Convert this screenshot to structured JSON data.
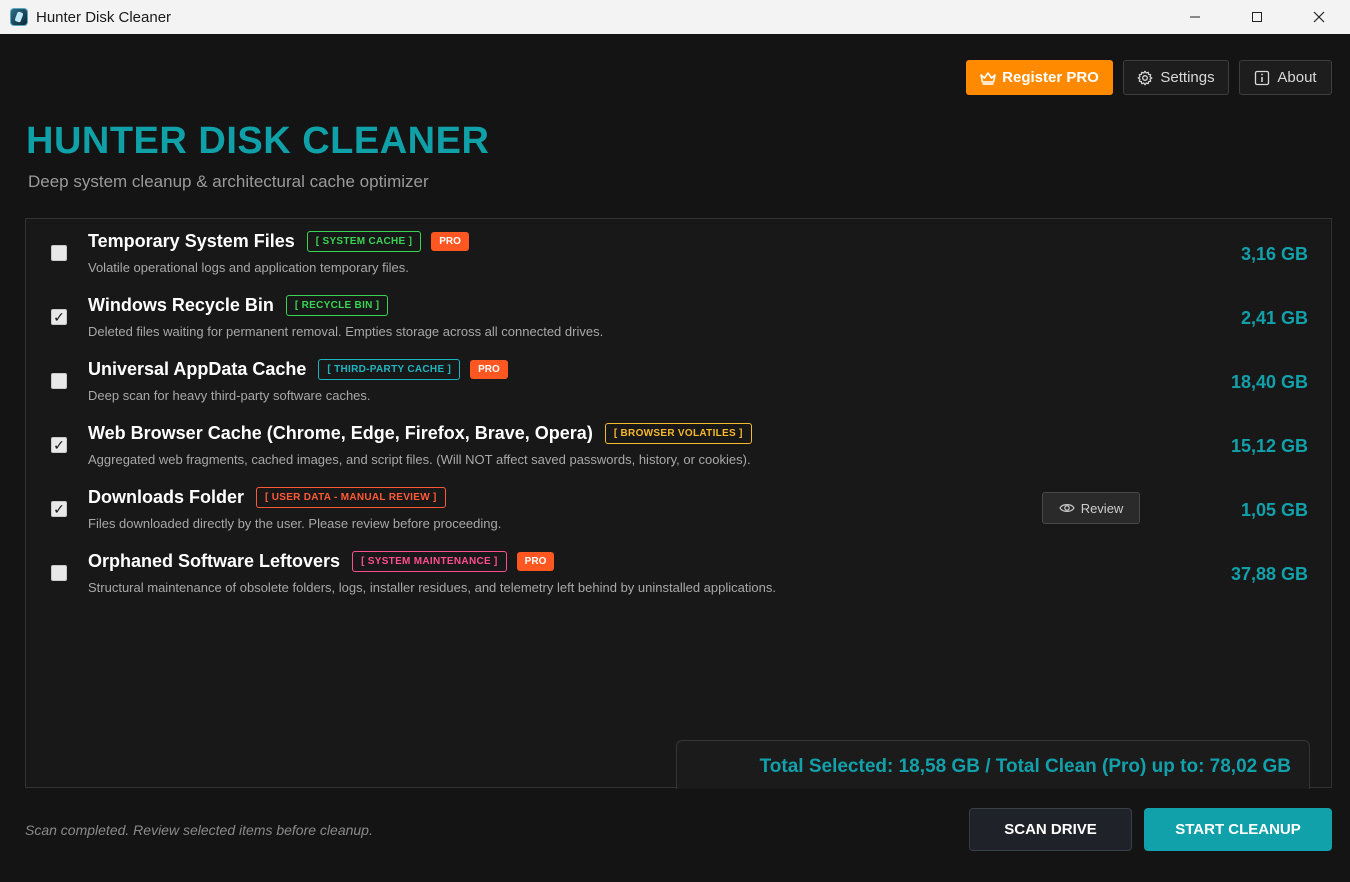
{
  "window": {
    "title": "Hunter Disk Cleaner"
  },
  "toolbar": {
    "register_label": "Register PRO",
    "settings_label": "Settings",
    "about_label": "About"
  },
  "header": {
    "title": "HUNTER DISK CLEANER",
    "subtitle": "Deep system cleanup & architectural cache optimizer"
  },
  "items": [
    {
      "title": "Temporary System Files",
      "tag": "[ SYSTEM CACHE ]",
      "tag_color": "#39d353",
      "pro": "PRO",
      "desc": "Volatile operational logs and application temporary files.",
      "size": "3,16 GB",
      "checked": false
    },
    {
      "title": "Windows Recycle Bin",
      "tag": "[ RECYCLE BIN ]",
      "tag_color": "#39d353",
      "desc": "Deleted files waiting for permanent removal. Empties storage across all connected drives.",
      "size": "2,41 GB",
      "checked": true
    },
    {
      "title": "Universal AppData Cache",
      "tag": "[ THIRD-PARTY CACHE ]",
      "tag_color": "#1fb5c0",
      "pro": "PRO",
      "desc": "Deep scan for heavy third-party software caches.",
      "size": "18,40 GB",
      "checked": false
    },
    {
      "title": "Web Browser Cache (Chrome, Edge, Firefox, Brave, Opera)",
      "tag": "[ BROWSER VOLATILES ]",
      "tag_color": "#f5b82e",
      "desc": "Aggregated web fragments, cached images, and script files. (Will NOT affect saved passwords, history, or cookies).",
      "size": "15,12 GB",
      "checked": true
    },
    {
      "title": "Downloads Folder",
      "tag": "[ USER DATA - MANUAL REVIEW ]",
      "tag_color": "#ff5a36",
      "desc": "Files downloaded directly by the user. Please review before proceeding.",
      "size": "1,05 GB",
      "checked": true,
      "review_label": "Review"
    },
    {
      "title": "Orphaned Software Leftovers",
      "tag": "[ SYSTEM MAINTENANCE ]",
      "tag_color": "#ff4d8d",
      "pro": "PRO",
      "desc": "Structural maintenance of obsolete folders, logs, installer residues, and telemetry left behind by uninstalled applications.",
      "size": "37,88 GB",
      "checked": false
    }
  ],
  "summary": {
    "text": "Total Selected: 18,58 GB / Total Clean (Pro) up to: 78,02 GB"
  },
  "footer": {
    "status": "Scan completed. Review selected items before cleanup.",
    "scan_label": "SCAN DRIVE",
    "cleanup_label": "START CLEANUP"
  },
  "colors": {
    "accent": "#12a0aa",
    "pro_orange": "#ff8a00",
    "pro_badge": "#ff5722"
  },
  "icons": {
    "app": "hunter-app-icon",
    "register": "crown-icon",
    "settings": "gear-icon",
    "about": "info-icon",
    "review": "eye-icon"
  }
}
